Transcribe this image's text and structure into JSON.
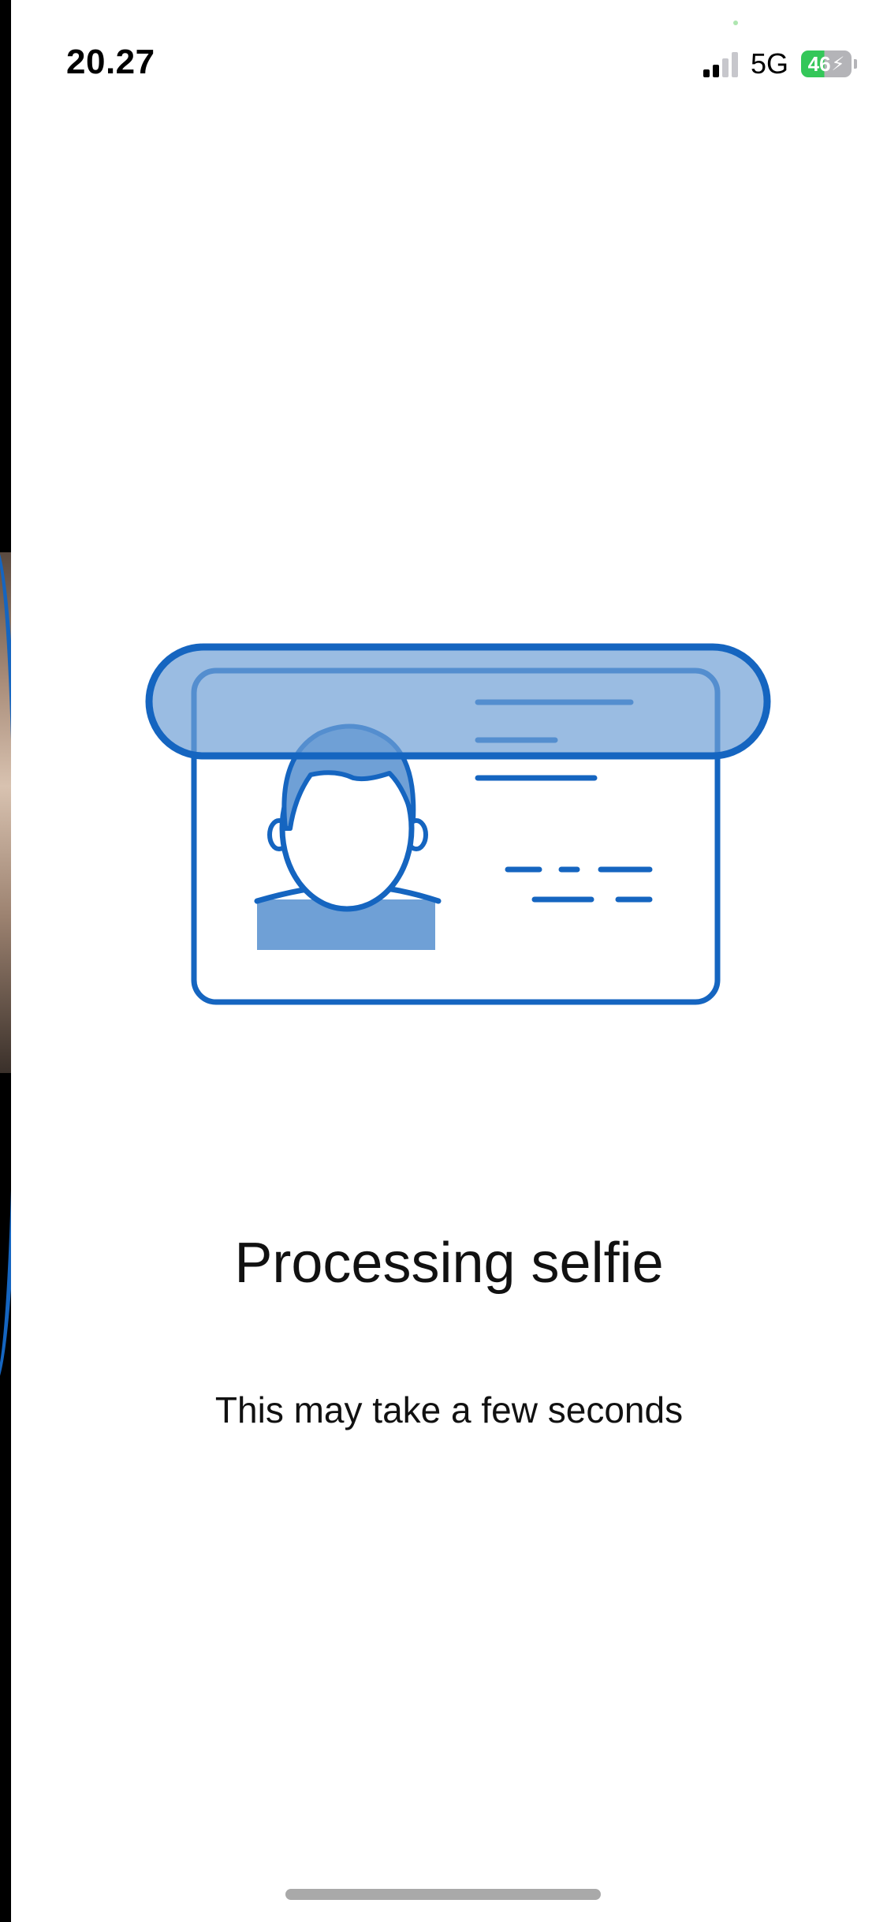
{
  "status_bar": {
    "time": "20.27",
    "network": "5G",
    "battery_level": "46",
    "battery_charging_symbol": "⚡",
    "battery_color": "#34c759"
  },
  "illustration": {
    "icon": "id-card-scan-icon",
    "accent_color": "#1565c0",
    "fill_color": "#6fa0d6"
  },
  "content": {
    "title": "Processing selfie",
    "subtitle": "This may take a few seconds"
  }
}
